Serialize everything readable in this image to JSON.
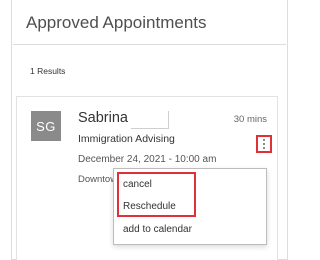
{
  "page": {
    "title": "Approved Appointments",
    "results_label": "1 Results"
  },
  "appointment": {
    "avatar_initials": "SG",
    "name": "Sabrina",
    "duration": "30 mins",
    "service": "Immigration Advising",
    "datetime": "December 24, 2021 - 10:00 am",
    "location": "Downtown"
  },
  "menu": {
    "items": [
      {
        "label": "cancel"
      },
      {
        "label": "Reschedule"
      },
      {
        "label": "add to calendar"
      }
    ]
  },
  "colors": {
    "highlight": "#e0303a",
    "avatar_bg": "#8a8a8a"
  },
  "icons": {
    "more": "vertical-ellipsis-icon"
  }
}
